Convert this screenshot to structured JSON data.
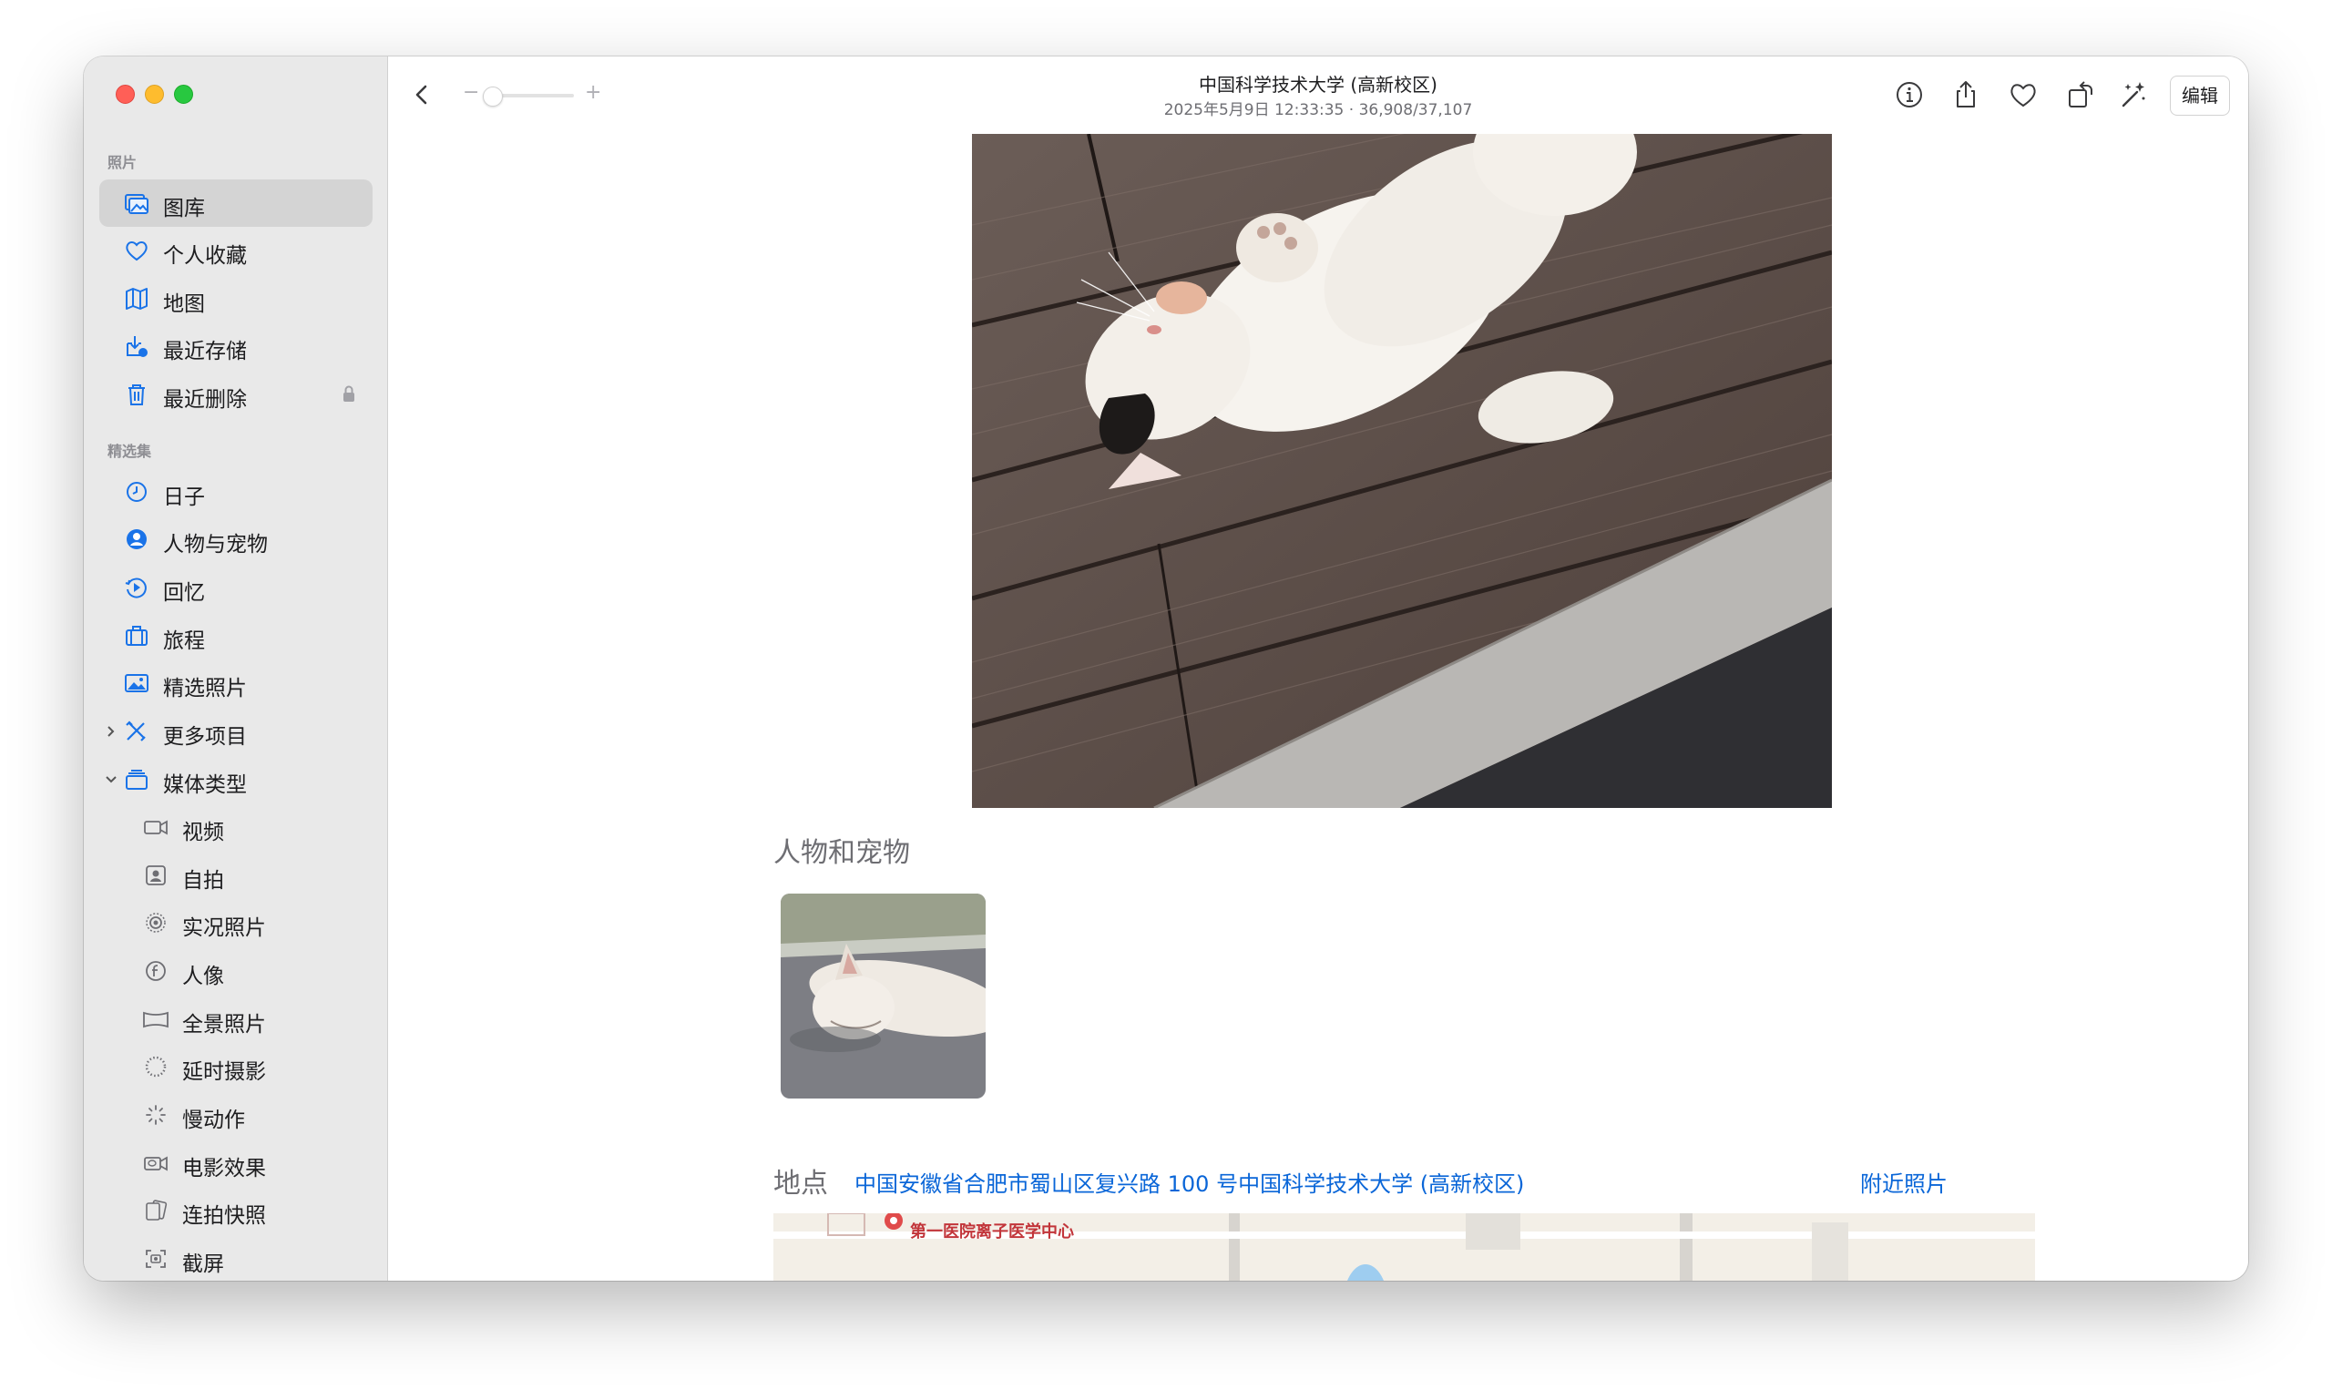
{
  "window": {
    "title": "中国科学技术大学 (高新校区)",
    "subtitle": "2025年5月9日 12:33:35 · 36,908/37,107"
  },
  "sidebar": {
    "section_photos": "照片",
    "section_collections": "精选集",
    "items": [
      {
        "label": "图库",
        "icon": "photo-library-icon",
        "selected": true
      },
      {
        "label": "个人收藏",
        "icon": "heart-icon"
      },
      {
        "label": "地图",
        "icon": "map-icon"
      },
      {
        "label": "最近存储",
        "icon": "recently-saved-icon"
      },
      {
        "label": "最近删除",
        "icon": "trash-icon",
        "locked": true
      },
      {
        "label": "日子",
        "icon": "clock-icon"
      },
      {
        "label": "人物与宠物",
        "icon": "person-circle-icon"
      },
      {
        "label": "回忆",
        "icon": "memories-icon"
      },
      {
        "label": "旅程",
        "icon": "suitcase-icon"
      },
      {
        "label": "精选照片",
        "icon": "featured-photo-icon"
      },
      {
        "label": "更多项目",
        "icon": "tools-icon",
        "expandable": true
      },
      {
        "label": "媒体类型",
        "icon": "stack-icon",
        "expanded": true
      },
      {
        "label": "视频",
        "icon": "video-icon"
      },
      {
        "label": "自拍",
        "icon": "selfie-icon"
      },
      {
        "label": "实况照片",
        "icon": "live-photo-icon"
      },
      {
        "label": "人像",
        "icon": "portrait-icon"
      },
      {
        "label": "全景照片",
        "icon": "panorama-icon"
      },
      {
        "label": "延时摄影",
        "icon": "timelapse-icon"
      },
      {
        "label": "慢动作",
        "icon": "slomo-icon"
      },
      {
        "label": "电影效果",
        "icon": "cinematic-icon"
      },
      {
        "label": "连拍快照",
        "icon": "burst-icon"
      },
      {
        "label": "截屏",
        "icon": "screenshot-icon"
      }
    ]
  },
  "toolbar": {
    "edit_label": "编辑",
    "zoom_minus": "−",
    "zoom_plus": "+",
    "zoom_level": 0
  },
  "content": {
    "people_heading": "人物和宠物",
    "place_heading": "地点",
    "place_address": "中国安徽省合肥市蜀山区复兴路 100 号中国科学技术大学 (高新校区)",
    "nearby_label": "附近照片",
    "map_poi": "第一医院离子医学中心"
  },
  "colors": {
    "accent": "#0a66d8",
    "sidebar_bg": "#e9e9e9",
    "selected_bg": "#d4d4d4",
    "icon_blue": "#1a73e8"
  }
}
